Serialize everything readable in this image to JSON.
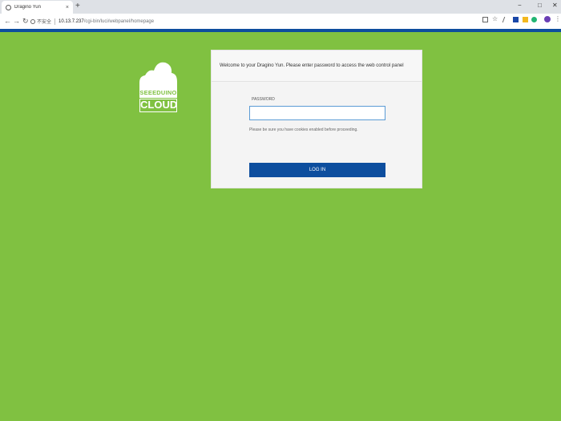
{
  "browser": {
    "tab_title": "Dragino Yun",
    "tab_close": "×",
    "new_tab": "+",
    "win_minimize": "−",
    "win_maximize": "□",
    "win_close": "✕",
    "back": "←",
    "forward": "→",
    "reload": "↻",
    "insecure_label": "不安全",
    "url_host": "10.13.7.237",
    "url_path": "/cgi-bin/luci/webpanel/homepage"
  },
  "colors": {
    "page_bg": "#80c141",
    "header_bar": "#0d4e9e",
    "button": "#0d4e9e"
  },
  "logo": {
    "top_text": "SEEEDUINO",
    "bottom_text": "CLOUD"
  },
  "login": {
    "welcome": "Welcome to your Dragino Yun. Please enter password to access the web control panel",
    "password_label": "PASSWORD",
    "password_value": "",
    "cookie_note": "Please be sure you have cookies enabled before proceeding.",
    "login_button": "LOG IN"
  }
}
